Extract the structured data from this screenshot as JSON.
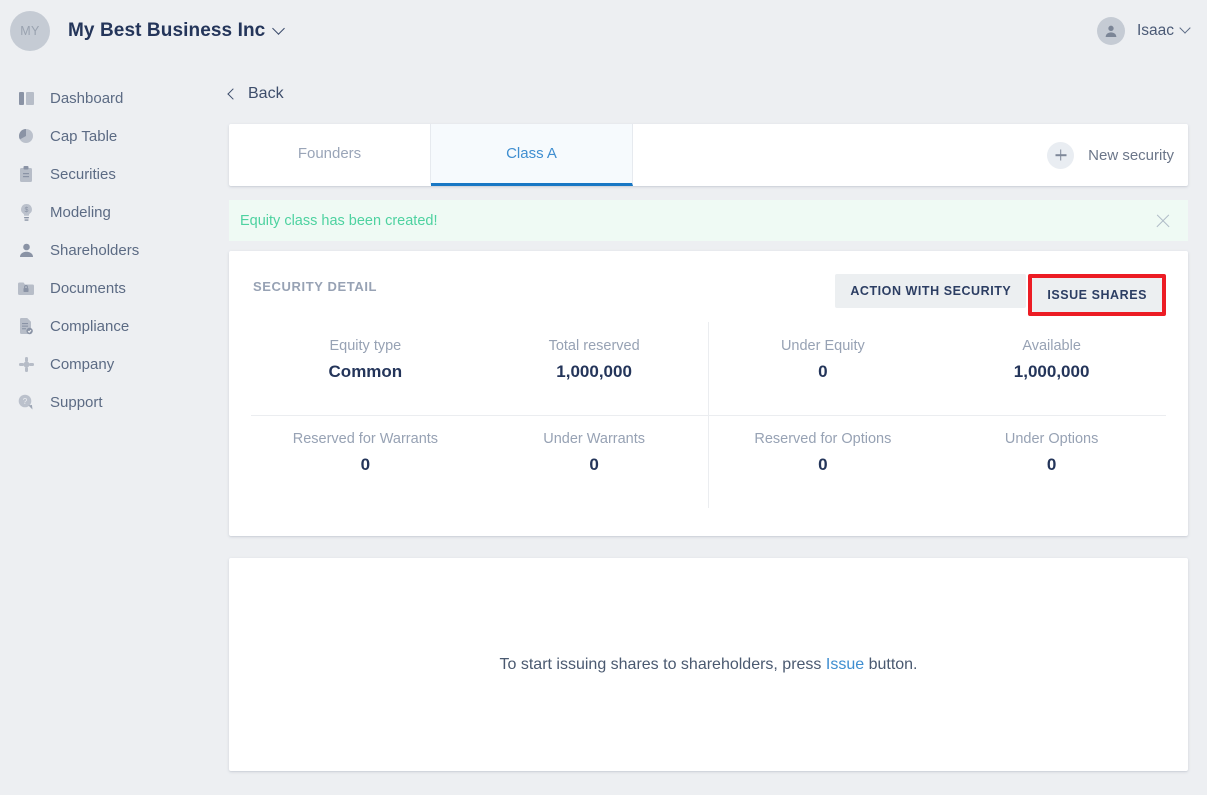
{
  "topbar": {
    "avatar_initials": "MY",
    "company_name": "My Best Business Inc",
    "user_name": "Isaac",
    "avatar_icon": "user-icon",
    "company_chevron_icon": "chevron-down-icon",
    "user_chevron_icon": "chevron-down-icon"
  },
  "sidebar": {
    "items": [
      {
        "label": "Dashboard",
        "icon": "dashboard-icon"
      },
      {
        "label": "Cap Table",
        "icon": "pie-chart-icon"
      },
      {
        "label": "Securities",
        "icon": "clipboard-icon"
      },
      {
        "label": "Modeling",
        "icon": "lightbulb-dollar-icon"
      },
      {
        "label": "Shareholders",
        "icon": "person-icon"
      },
      {
        "label": "Documents",
        "icon": "folder-lock-icon"
      },
      {
        "label": "Compliance",
        "icon": "document-check-icon"
      },
      {
        "label": "Company",
        "icon": "company-icon"
      },
      {
        "label": "Support",
        "icon": "question-bubble-icon"
      }
    ]
  },
  "main": {
    "back_label": "Back",
    "back_icon": "chevron-left-icon",
    "tabs": [
      {
        "label": "Founders",
        "active": false
      },
      {
        "label": "Class A",
        "active": true
      }
    ],
    "new_security_label": "New security",
    "new_security_icon": "plus-icon",
    "alert": {
      "message": "Equity class has been created!",
      "close_icon": "close-icon",
      "color": "#4ed2a0",
      "background": "#effaf4"
    },
    "detail": {
      "title": "SECURITY DETAIL",
      "action_button_label": "ACTION WITH SECURITY",
      "issue_button_label": "ISSUE SHARES",
      "issue_button_highlight_color": "#ec1c24",
      "stats_row_1": [
        {
          "label": "Equity type",
          "value": "Common"
        },
        {
          "label": "Total reserved",
          "value": "1,000,000"
        },
        {
          "label": "Under Equity",
          "value": "0"
        },
        {
          "label": "Available",
          "value": "1,000,000"
        }
      ],
      "stats_row_2": [
        {
          "label": "Reserved for Warrants",
          "value": "0"
        },
        {
          "label": "Under Warrants",
          "value": "0"
        },
        {
          "label": "Reserved for Options",
          "value": "0"
        },
        {
          "label": "Under Options",
          "value": "0"
        }
      ]
    },
    "empty_state": {
      "text_before": "To start issuing shares to shareholders, press ",
      "link_text": "Issue",
      "text_after": " button."
    }
  }
}
